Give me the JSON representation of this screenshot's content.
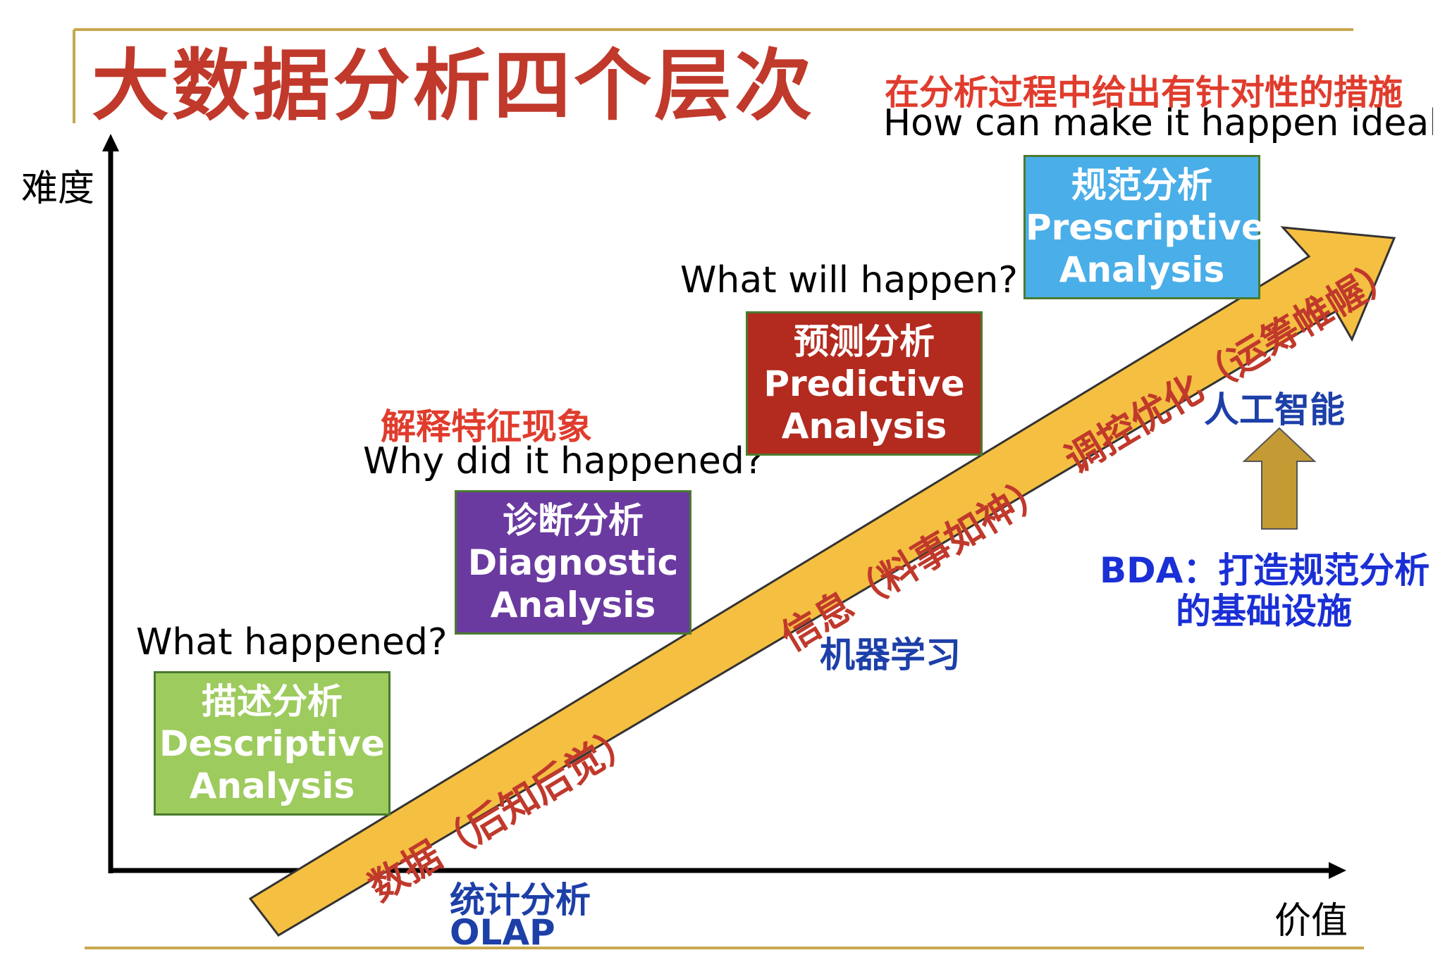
{
  "title": "大数据分析四个层次",
  "axes": {
    "y_label": "难度",
    "x_label": "价值"
  },
  "levels": [
    {
      "question": "What happened?",
      "zh": "描述分析",
      "en": "Descriptive Analysis",
      "color": "#9dcb5e"
    },
    {
      "note": "解释特征现象",
      "question": "Why did it happened?",
      "zh": "诊断分析",
      "en": "Diagnostic Analysis",
      "color": "#6a3aa0"
    },
    {
      "question": "What will happen?",
      "zh": "预测分析",
      "en": "Predictive Analysis",
      "color": "#b32a1f"
    },
    {
      "note": "在分析过程中给出有针对性的措施",
      "question": "How can make it happen ideally?",
      "zh": "规范分析",
      "en": "Prescriptive Analysis",
      "color": "#4aaee8"
    }
  ],
  "band": {
    "segments": [
      "数据（后知后觉）",
      "信息（料事如神）",
      "调控优化（运筹帷幄）"
    ],
    "color": "#f5bf42"
  },
  "tech_labels": {
    "olap_zh": "统计分析",
    "olap_en": "OLAP",
    "ml": "机器学习",
    "ai": "人工智能",
    "bda_line1": "BDA：打造规范分析",
    "bda_line2": "的基础设施"
  },
  "colors": {
    "title": "#c0392b",
    "blue_labels": "#1d3fa8",
    "gold_rule": "#c8a84e",
    "up_arrow": "#c49a35"
  }
}
